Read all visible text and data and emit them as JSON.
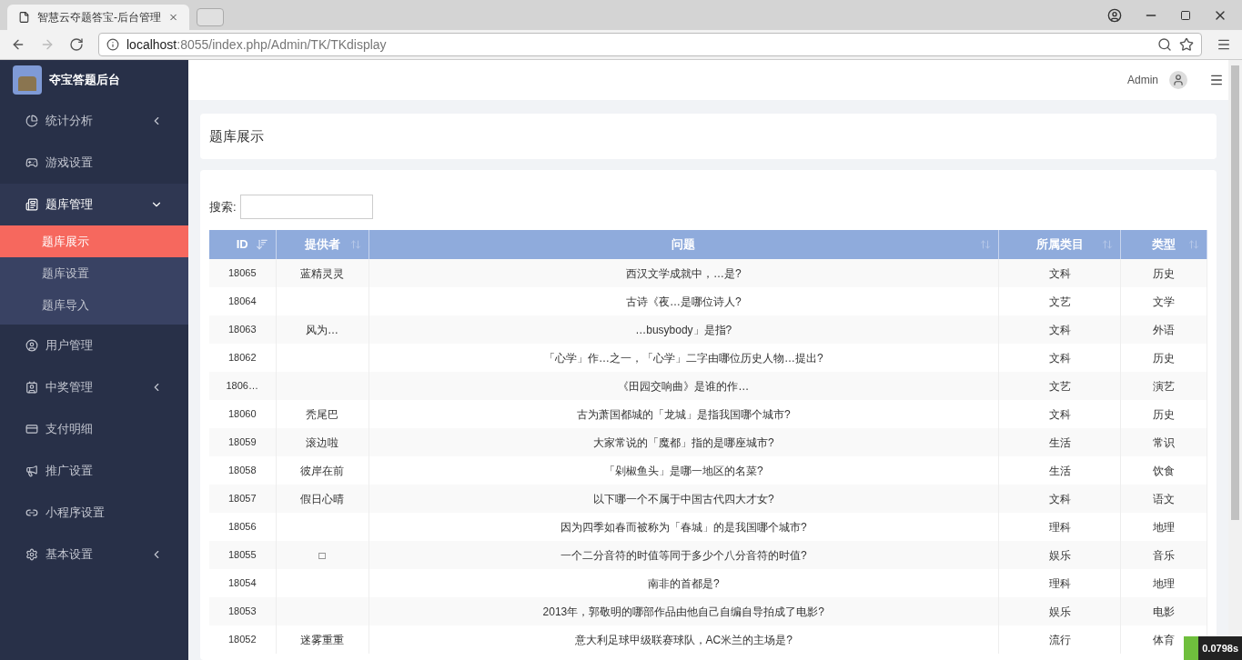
{
  "browser": {
    "tab_title": "智慧云夺题答宝-后台管理",
    "url_host": "localhost",
    "url_path": ":8055/index.php/Admin/TK/TKdisplay"
  },
  "sidebar": {
    "brand": "夺宝答题后台",
    "items": [
      {
        "label": "统计分析",
        "kind": "collapsible",
        "expanded": false
      },
      {
        "label": "游戏设置",
        "kind": "link"
      },
      {
        "label": "题库管理",
        "kind": "collapsible",
        "expanded": true,
        "children": [
          {
            "label": "题库展示",
            "selected": true
          },
          {
            "label": "题库设置",
            "selected": false
          },
          {
            "label": "题库导入",
            "selected": false
          }
        ]
      },
      {
        "label": "用户管理",
        "kind": "link"
      },
      {
        "label": "中奖管理",
        "kind": "collapsible",
        "expanded": false
      },
      {
        "label": "支付明细",
        "kind": "link"
      },
      {
        "label": "推广设置",
        "kind": "link"
      },
      {
        "label": "小程序设置",
        "kind": "link"
      },
      {
        "label": "基本设置",
        "kind": "collapsible",
        "expanded": false
      }
    ]
  },
  "header": {
    "user": "Admin"
  },
  "page_title": "题库展示",
  "search": {
    "label": "搜索:"
  },
  "table": {
    "columns": [
      {
        "label": "ID",
        "sorted": true
      },
      {
        "label": "提供者",
        "sorted": false
      },
      {
        "label": "问题",
        "sorted": false
      },
      {
        "label": "所属类目",
        "sorted": false
      },
      {
        "label": "类型",
        "sorted": false
      }
    ],
    "rows": [
      [
        "18065",
        "蓝精灵灵",
        "西汉文学成就中，…是?",
        "文科",
        "历史"
      ],
      [
        "18064",
        "",
        "古诗《夜…是哪位诗人?",
        "文艺",
        "文学"
      ],
      [
        "18063",
        "风为…",
        "…busybody」是指?",
        "文科",
        "外语"
      ],
      [
        "18062",
        "",
        "「心学」作…之一，「心学」二字由哪位历史人物…提出?",
        "文科",
        "历史"
      ],
      [
        "1806…",
        "",
        "《田园交响曲》是谁的作…",
        "文艺",
        "演艺"
      ],
      [
        "18060",
        "秃尾巴",
        "古为萧国都城的「龙城」是指我国哪个城市?",
        "文科",
        "历史"
      ],
      [
        "18059",
        "滚边啦",
        "大家常说的「魔都」指的是哪座城市?",
        "生活",
        "常识"
      ],
      [
        "18058",
        "彼岸在前",
        "「剁椒鱼头」是哪一地区的名菜?",
        "生活",
        "饮食"
      ],
      [
        "18057",
        "假日心晴",
        "以下哪一个不属于中国古代四大才女?",
        "文科",
        "语文"
      ],
      [
        "18056",
        "",
        "因为四季如春而被称为「春城」的是我国哪个城市?",
        "理科",
        "地理"
      ],
      [
        "18055",
        "□",
        "一个二分音符的时值等同于多少个八分音符的时值?",
        "娱乐",
        "音乐"
      ],
      [
        "18054",
        "",
        "南非的首都是?",
        "理科",
        "地理"
      ],
      [
        "18053",
        "",
        "2013年，郭敬明的哪部作品由他自己自编自导拍成了电影?",
        "娱乐",
        "电影"
      ],
      [
        "18052",
        "迷雾重重",
        "意大利足球甲级联赛球队，AC米兰的主场是?",
        "流行",
        "体育"
      ]
    ]
  },
  "timer_badge": "0.0798s"
}
